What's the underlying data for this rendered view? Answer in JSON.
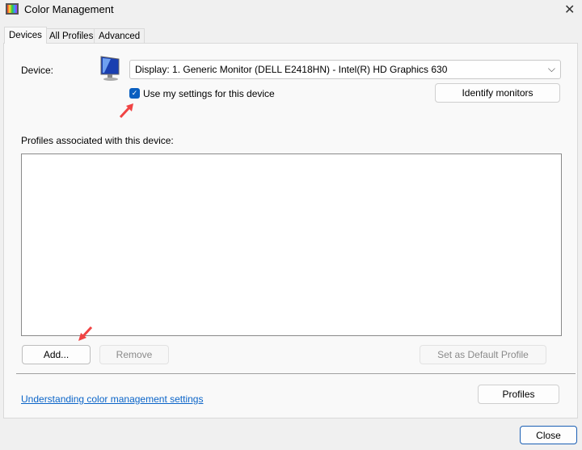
{
  "window": {
    "title": "Color Management",
    "close_icon": "close-icon"
  },
  "tabs": [
    {
      "label": "Devices",
      "active": true
    },
    {
      "label": "All Profiles"
    },
    {
      "label": "Advanced"
    }
  ],
  "device": {
    "label": "Device:",
    "selected": "Display: 1. Generic Monitor (DELL E2418HN) - Intel(R) HD Graphics 630",
    "use_my_settings_label": "Use my settings for this device",
    "use_my_settings_checked": true,
    "identify_button": "Identify monitors"
  },
  "profiles": {
    "label": "Profiles associated with this device:",
    "items": [],
    "add_button": "Add...",
    "remove_button": "Remove",
    "set_default_button": "Set as Default Profile"
  },
  "footer": {
    "link": "Understanding color management settings",
    "profiles_button": "Profiles",
    "close_button": "Close"
  },
  "colors": {
    "accent": "#0a64c8",
    "annotation_arrow": "#f04444"
  }
}
